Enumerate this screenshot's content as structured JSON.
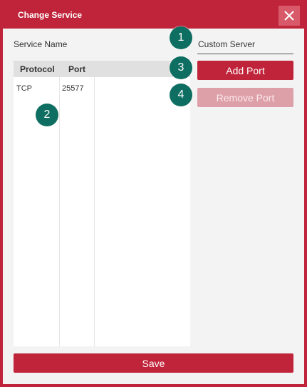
{
  "dialog": {
    "title": "Change Service",
    "close_icon": "close-icon"
  },
  "form": {
    "service_name_label": "Service Name",
    "service_name_value": "Custom Server"
  },
  "ports_table": {
    "columns": [
      "Protocol",
      "Port"
    ],
    "rows": [
      {
        "protocol": "TCP",
        "port": "25577"
      }
    ]
  },
  "buttons": {
    "add_port": "Add Port",
    "remove_port": "Remove Port",
    "save": "Save"
  },
  "badges": [
    "1",
    "2",
    "3",
    "4"
  ],
  "colors": {
    "accent": "#c0243a",
    "accent_disabled": "#dea0a8",
    "badge": "#0e6e61",
    "panel": "#f3f3f3"
  }
}
